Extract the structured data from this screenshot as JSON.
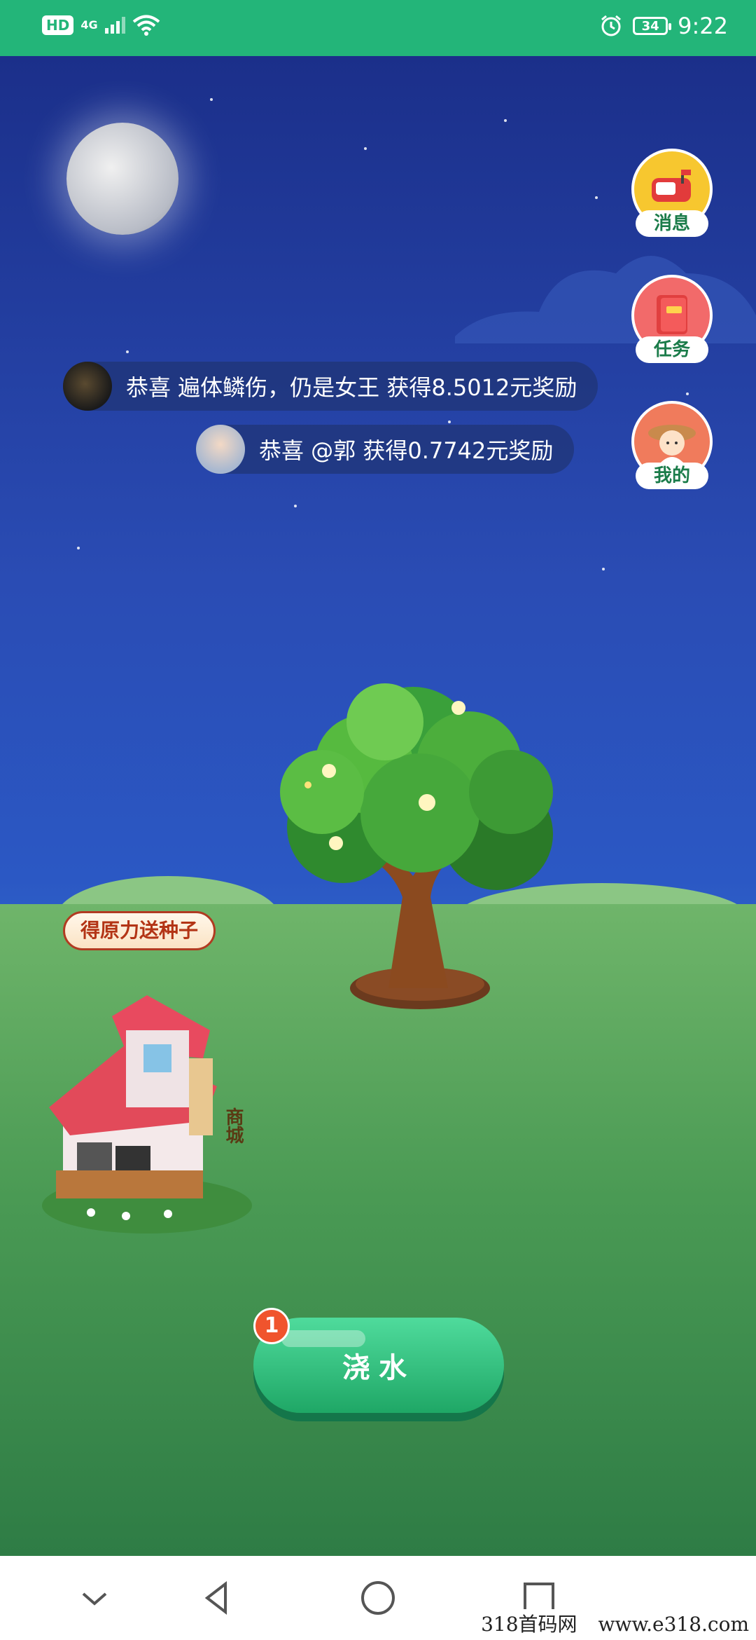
{
  "status_bar": {
    "hd_label": "HD",
    "network_label": "4G",
    "battery_level": "34",
    "time": "9:22",
    "icons": [
      "signal-icon",
      "wifi-icon",
      "alarm-icon",
      "battery-icon"
    ],
    "background": "#23b579"
  },
  "side_menu": [
    {
      "label": "消息",
      "icon": "mailbox-icon",
      "color": "#f7c72f"
    },
    {
      "label": "任务",
      "icon": "task-book-icon",
      "color": "#f26a6a"
    },
    {
      "label": "我的",
      "icon": "farmer-avatar-icon",
      "color": "#f07b5c"
    }
  ],
  "notices": [
    {
      "text": "恭喜 遍体鳞伤，仍是女王 获得8.5012元奖励"
    },
    {
      "text": "恭喜 @郭 获得0.7742元奖励"
    }
  ],
  "shop": {
    "badge": "得原力送种子",
    "sign": "商城"
  },
  "water_button": {
    "label": "浇水",
    "badge_count": "1"
  },
  "nav_bar": {
    "icons": [
      "collapse-chevron-icon",
      "back-triangle-icon",
      "home-circle-icon",
      "recents-square-icon"
    ]
  },
  "watermark": {
    "left": "318首码网",
    "right": "www.e318.com"
  }
}
